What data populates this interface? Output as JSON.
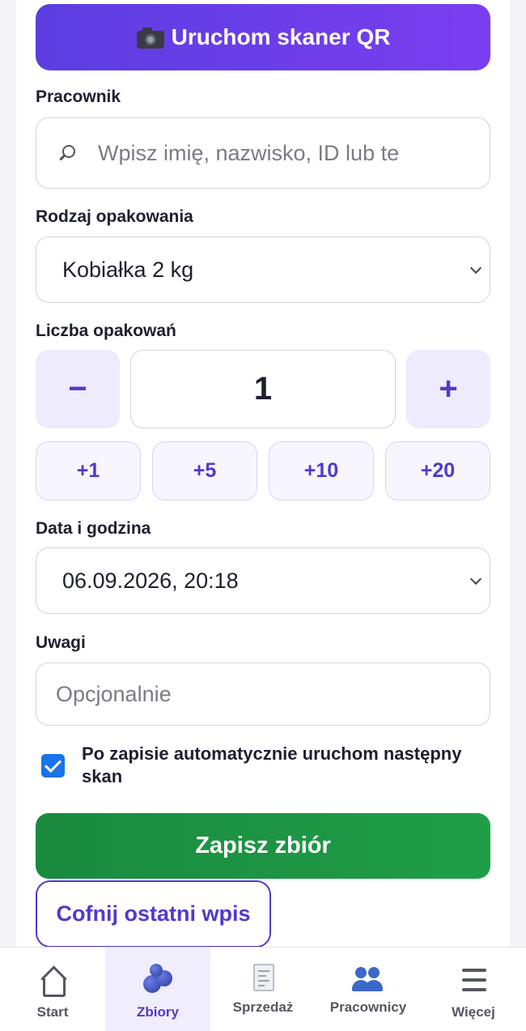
{
  "scan": {
    "label": "Uruchom skaner QR",
    "icon": "camera-icon"
  },
  "worker": {
    "label": "Pracownik",
    "placeholder": "Wpisz imię, nazwisko, ID lub te"
  },
  "packaging": {
    "label": "Rodzaj opakowania",
    "selected": "Kobiałka 2 kg"
  },
  "quantity": {
    "label": "Liczba opakowań",
    "value": "1",
    "minus": "−",
    "plus": "+",
    "quick": [
      "+1",
      "+5",
      "+10",
      "+20"
    ]
  },
  "datetime": {
    "label": "Data i godzina",
    "value": "06.09.2026, 20:18"
  },
  "notes": {
    "label": "Uwagi",
    "placeholder": "Opcjonalnie"
  },
  "auto_scan": {
    "checked": true,
    "label": "Po zapisie automatycznie uruchom następny skan"
  },
  "actions": {
    "save": "Zapisz zbiór",
    "undo": "Cofnij ostatni wpis"
  },
  "nav": {
    "items": [
      {
        "label": "Start",
        "icon": "home-icon",
        "active": false
      },
      {
        "label": "Zbiory",
        "icon": "blueberries-icon",
        "active": true
      },
      {
        "label": "Sprzedaż",
        "icon": "receipt-icon",
        "active": false
      },
      {
        "label": "Pracownicy",
        "icon": "people-icon",
        "active": false
      },
      {
        "label": "Więcej",
        "icon": "menu-icon",
        "active": false
      }
    ]
  },
  "colors": {
    "accent": "#4f3bc9",
    "scan_gradient": [
      "#5b3ee0",
      "#7a3ef0"
    ],
    "save_green": "#1f9e48",
    "checkbox_blue": "#1a73e8"
  }
}
